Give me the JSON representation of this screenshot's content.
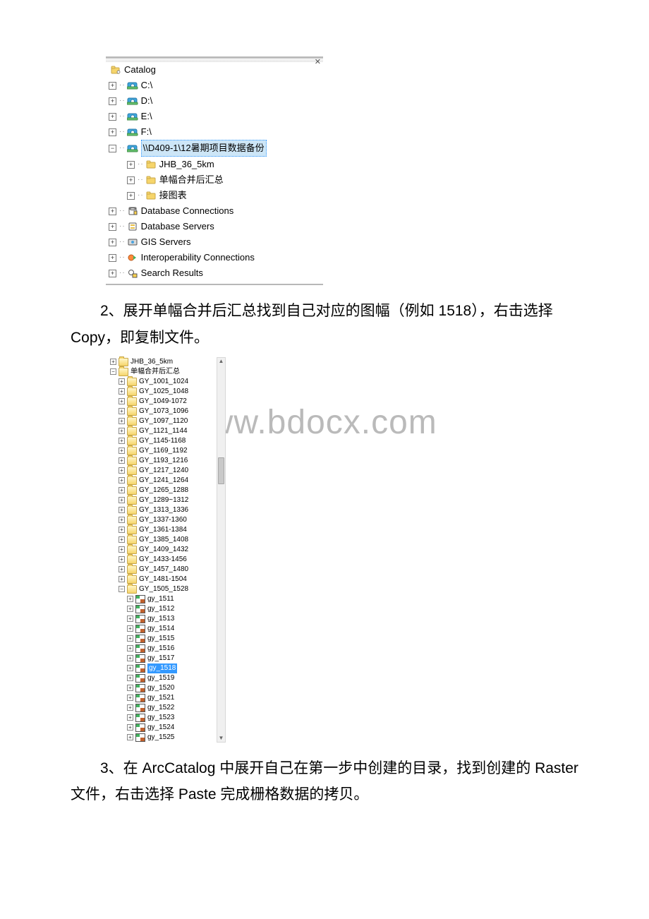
{
  "panel1": {
    "root": "Catalog",
    "drives": [
      "C:\\",
      "D:\\",
      "E:\\",
      "F:\\"
    ],
    "network_selected": "\\\\D409-1\\12暑期项目数据备份",
    "network_children": [
      "JHB_36_5km",
      "单幅合并后汇总",
      "接图表"
    ],
    "others": [
      "Database Connections",
      "Database Servers",
      "GIS Servers",
      "Interoperability Connections",
      "Search Results"
    ]
  },
  "para2": "2、展开单幅合并后汇总找到自己对应的图幅（例如 1518），右击选择 Copy，即复制文件。",
  "panel2": {
    "top_folder": "JHB_36_5km",
    "group_folder": "单幅合并后汇总",
    "group_folder_open": true,
    "subfolders": [
      "GY_1001_1024",
      "GY_1025_1048",
      "GY_1049-1072",
      "GY_1073_1096",
      "GY_1097_1120",
      "GY_1121_1144",
      "GY_1145-1168",
      "GY_1169_1192",
      "GY_1193_1216",
      "GY_1217_1240",
      "GY_1241_1264",
      "GY_1265_1288",
      "GY_1289~1312",
      "GY_1313_1336",
      "GY_1337-1360",
      "GY_1361-1384",
      "GY_1385_1408",
      "GY_1409_1432",
      "GY_1433-1456",
      "GY_1457_1480",
      "GY_1481-1504"
    ],
    "open_subfolder": "GY_1505_1528",
    "rasters": [
      "gy_1511",
      "gy_1512",
      "gy_1513",
      "gy_1514",
      "gy_1515",
      "gy_1516",
      "gy_1517",
      "gy_1518",
      "gy_1519",
      "gy_1520",
      "gy_1521",
      "gy_1522",
      "gy_1523",
      "gy_1524",
      "gy_1525"
    ],
    "selected_raster": "gy_1518"
  },
  "watermark": "www.bdocx.com",
  "para3": "3、在 ArcCatalog 中展开自己在第一步中创建的目录，找到创建的 Raster 文件，右击选择 Paste 完成栅格数据的拷贝。"
}
